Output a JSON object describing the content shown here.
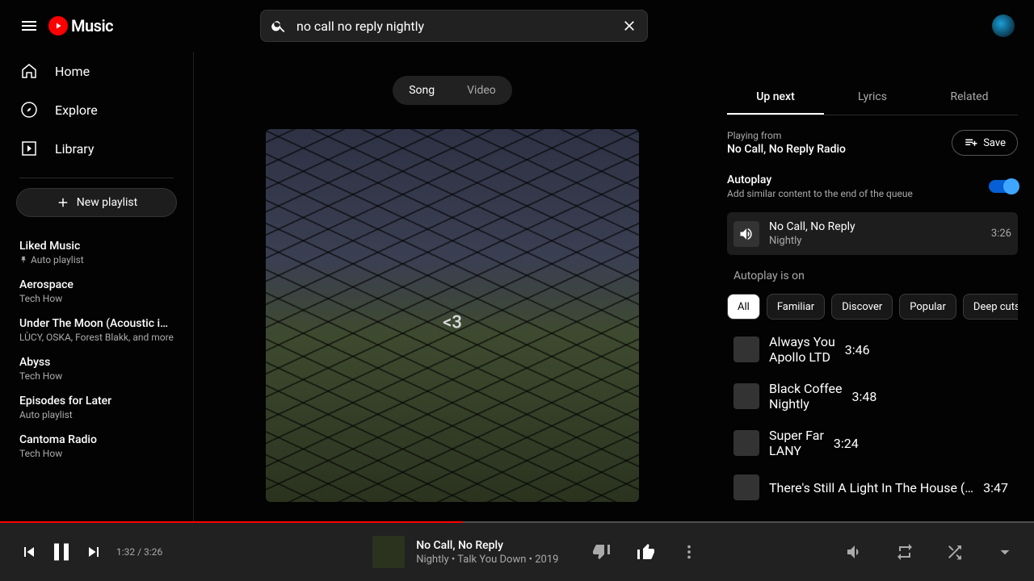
{
  "brand": "Music",
  "search": {
    "query": "no call no reply nightly"
  },
  "nav": {
    "home": "Home",
    "explore": "Explore",
    "library": "Library",
    "new_playlist": "New playlist"
  },
  "sidebar_playlists": [
    {
      "title": "Liked Music",
      "sub": "Auto playlist",
      "pinned": true
    },
    {
      "title": "Aerospace",
      "sub": "Tech How"
    },
    {
      "title": "Under The Moon (Acoustic i…",
      "sub": "LÙCY, OSKA, Forest Blakk, and more"
    },
    {
      "title": "Abyss",
      "sub": "Tech How"
    },
    {
      "title": "Episodes for Later",
      "sub": "Auto playlist"
    },
    {
      "title": "Cantoma Radio",
      "sub": "Tech How"
    }
  ],
  "view_toggle": {
    "song": "Song",
    "video": "Video",
    "active": "song"
  },
  "panel": {
    "tabs": {
      "upnext": "Up next",
      "lyrics": "Lyrics",
      "related": "Related"
    },
    "from_label": "Playing from",
    "from_name": "No Call, No Reply Radio",
    "save": "Save",
    "autoplay_title": "Autoplay",
    "autoplay_sub": "Add similar content to the end of the queue",
    "now": {
      "title": "No Call, No Reply",
      "artist": "Nightly",
      "duration": "3:26"
    },
    "autoplay_on": "Autoplay is on",
    "chips": [
      "All",
      "Familiar",
      "Discover",
      "Popular",
      "Deep cuts"
    ],
    "queue": [
      {
        "title": "Always You",
        "artist": "Apollo LTD",
        "duration": "3:46"
      },
      {
        "title": "Black Coffee",
        "artist": "Nightly",
        "duration": "3:48"
      },
      {
        "title": "Super Far",
        "artist": "LANY",
        "duration": "3:24"
      },
      {
        "title": "There's Still A Light In The House (…",
        "artist": "",
        "duration": "3:47"
      }
    ]
  },
  "player": {
    "elapsed": "1:32",
    "total": "3:26",
    "sep": " / ",
    "title": "No Call, No Reply",
    "meta": "Nightly • Talk You Down • 2019",
    "progress_pct": 44.8
  }
}
